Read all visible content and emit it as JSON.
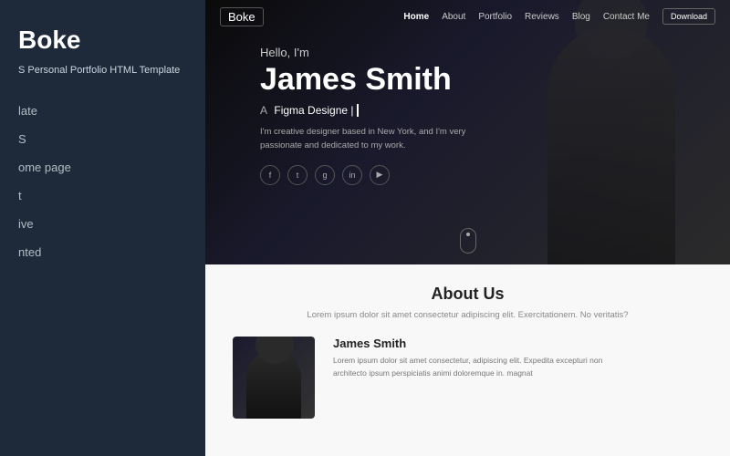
{
  "leftPanel": {
    "brand": "Boke",
    "subtitle": "S Personal Portfolio HTML Template",
    "navItems": [
      {
        "label": "late",
        "id": "template"
      },
      {
        "label": "S",
        "id": "features"
      },
      {
        "label": "ome page",
        "id": "homepage"
      },
      {
        "label": "t",
        "id": "about"
      },
      {
        "label": "ive",
        "id": "responsive"
      },
      {
        "label": "nted",
        "id": "oriented"
      }
    ]
  },
  "topNav": {
    "logo": "Boke",
    "links": [
      {
        "label": "Home",
        "active": true
      },
      {
        "label": "About"
      },
      {
        "label": "Portfolio"
      },
      {
        "label": "Reviews"
      },
      {
        "label": "Blog"
      },
      {
        "label": "Contact Me"
      }
    ],
    "downloadBtn": "Download"
  },
  "hero": {
    "greeting": "Hello, I'm",
    "name": "James Smith",
    "rolePrefix": "A",
    "role": "Figma Designe |",
    "description": "I'm creative designer based in New York, and I'm very passionate and dedicated to my work.",
    "socialIcons": [
      "f",
      "t",
      "g",
      "in",
      "yt"
    ]
  },
  "about": {
    "title": "About Us",
    "subtitle": "Lorem ipsum dolor sit amet consectetur adipiscing elit. Exercitationem. No\nveritatis?",
    "personName": "James Smith",
    "personDesc": "Lorem ipsum dolor sit amet consectetur, adipiscing elit. Expedita excepturi non architecto ipsum perspiciatis animi doloremque in.\nmagnat"
  }
}
